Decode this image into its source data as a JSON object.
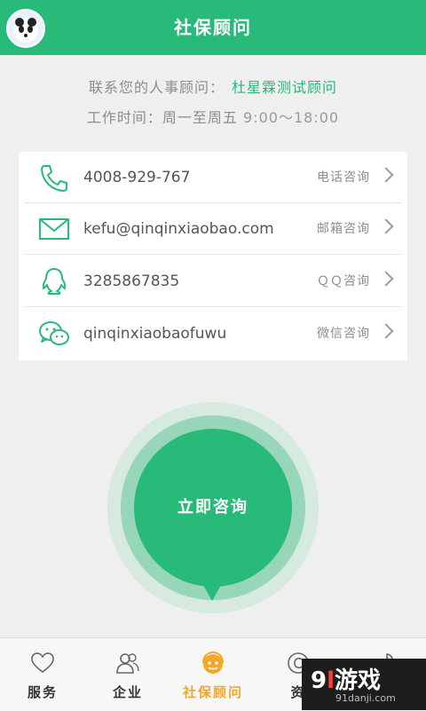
{
  "header": {
    "title": "社保顾问"
  },
  "info": {
    "contact_label": "联系您的人事顾问：",
    "advisor_name": "杜星霖测试顾问",
    "hours_label": "工作时间：周一至周五",
    "hours_value": "9:00～18:00"
  },
  "contacts": [
    {
      "icon": "phone-icon",
      "value": "4008-929-767",
      "action": "电话咨询"
    },
    {
      "icon": "mail-icon",
      "value": "kefu@qinqinxiaobao.com",
      "action": "邮箱咨询"
    },
    {
      "icon": "qq-icon",
      "value": "3285867835",
      "action": "ＱＱ咨询"
    },
    {
      "icon": "wechat-icon",
      "value": "qinqinxiaobaofuwu",
      "action": "微信咨询"
    }
  ],
  "consult_button": {
    "label": "立即咨询"
  },
  "tabs": [
    {
      "icon": "heart-icon",
      "label": "服务"
    },
    {
      "icon": "people-icon",
      "label": "企业"
    },
    {
      "icon": "advisor-icon",
      "label": "社保顾问",
      "active": true
    },
    {
      "icon": "copyright-icon",
      "label": "资"
    },
    {
      "icon": "wrench-icon",
      "label": ""
    }
  ],
  "watermark": {
    "big_1": "9",
    "big_2": "l",
    "big_3": "游戏",
    "small": "91danji.com"
  },
  "colors": {
    "brand_green": "#27ba78",
    "accent_orange": "#f5a623"
  }
}
